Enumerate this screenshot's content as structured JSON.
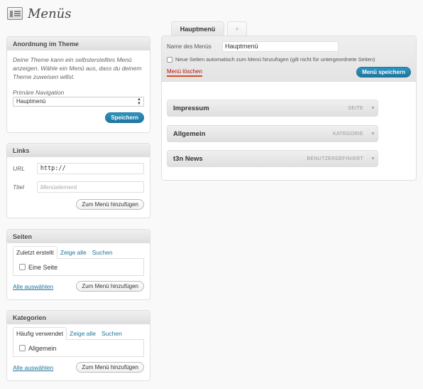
{
  "page": {
    "title": "Menüs",
    "icon": "menus-icon"
  },
  "theme_box": {
    "title": "Anordnung im Theme",
    "description": "Deine Theme kann ein selbsterstelltes Menü anzeigen. Wähle ein Menü aus, dass du deinem Theme zuweisen willst.",
    "primary_nav_label": "Primäre Navigation",
    "select_value": "Hauptmenü",
    "save_label": "Speichern"
  },
  "links_box": {
    "title": "Links",
    "url_label": "URL",
    "url_value": "http://",
    "title_label": "Titel",
    "title_placeholder": "Menüelement",
    "add_label": "Zum Menü hinzufügen"
  },
  "pages_box": {
    "title": "Seiten",
    "tabs": [
      "Zuletzt erstellt",
      "Zeige alle",
      "Suchen"
    ],
    "item": "Eine Seite",
    "select_all": "Alle auswählen",
    "add_label": "Zum Menü hinzufügen"
  },
  "categories_box": {
    "title": "Kategorien",
    "tabs": [
      "Häufig verwendet",
      "Zeige alle",
      "Suchen"
    ],
    "item": "Allgemein",
    "select_all": "Alle auswählen",
    "add_label": "Zum Menü hinzufügen"
  },
  "editor": {
    "active_tab": "Hauptmenü",
    "add_tab": "+",
    "name_label": "Name des Menüs",
    "name_value": "Hauptmenü",
    "auto_add_label": "Neue Seiten automatisch zum Menü hinzufügen (gilt nicht für untergeordnete Seiten)",
    "delete_label": "Menü löschen",
    "save_label": "Menü speichern",
    "items": [
      {
        "title": "Impressum",
        "type": "SEITE"
      },
      {
        "title": "Allgemein",
        "type": "KATEGORIE"
      },
      {
        "title": "t3n News",
        "type": "BENUTZERDEFINIERT"
      }
    ]
  },
  "colors": {
    "accent": "#21759b",
    "delete": "#bc0b0b"
  }
}
